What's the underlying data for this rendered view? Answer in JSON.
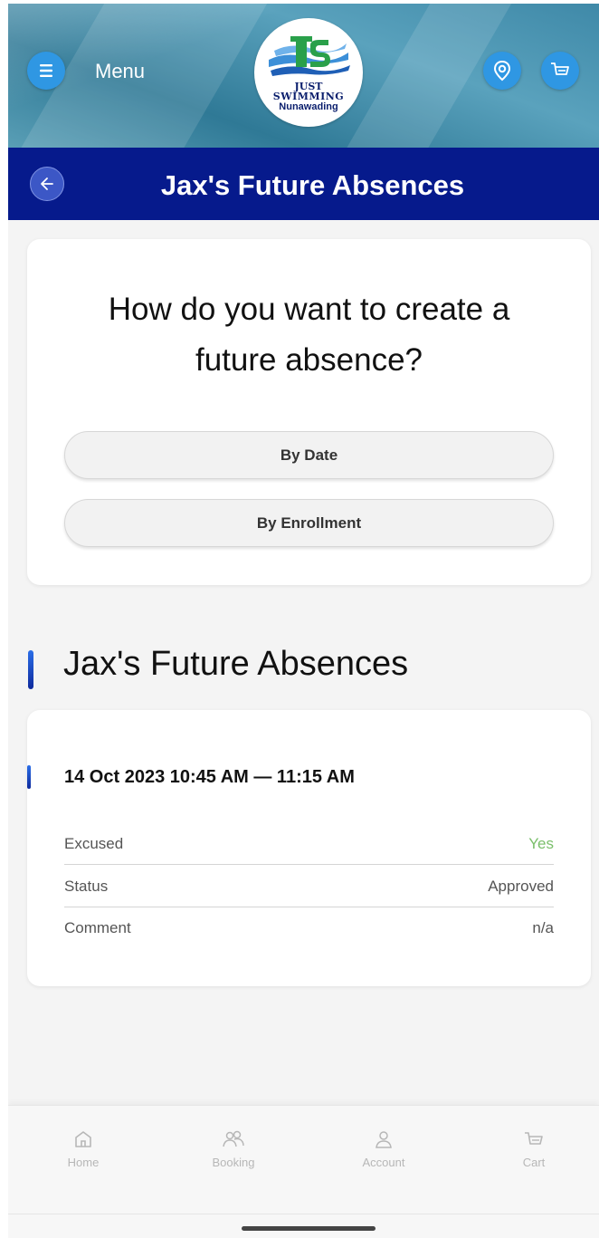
{
  "header": {
    "menu_label": "Menu",
    "logo": {
      "line1": "JUST",
      "line2": "SWIMMING",
      "line3": "Nunawading",
      "monogram": "JS"
    },
    "icons": [
      "menu-icon",
      "location-icon",
      "cart-icon"
    ],
    "accent_color": "#2f97e3"
  },
  "titlebar": {
    "title": "Jax's Future Absences",
    "background": "#061a8c"
  },
  "create_card": {
    "question": "How do you want to create a future absence?",
    "options": [
      {
        "label": "By Date"
      },
      {
        "label": "By Enrollment"
      }
    ]
  },
  "absences_section": {
    "title": "Jax's Future Absences",
    "items": [
      {
        "datetime": "14 Oct 2023 10:45 AM — 11:15 AM",
        "fields": [
          {
            "label": "Excused",
            "value": "Yes"
          },
          {
            "label": "Status",
            "value": "Approved"
          },
          {
            "label": "Comment",
            "value": "n/a"
          }
        ]
      }
    ]
  },
  "tabbar": {
    "tabs": [
      {
        "label": "Home",
        "icon": "home-icon"
      },
      {
        "label": "Booking",
        "icon": "people-icon"
      },
      {
        "label": "Account",
        "icon": "person-icon"
      },
      {
        "label": "Cart",
        "icon": "cart-icon"
      }
    ]
  }
}
